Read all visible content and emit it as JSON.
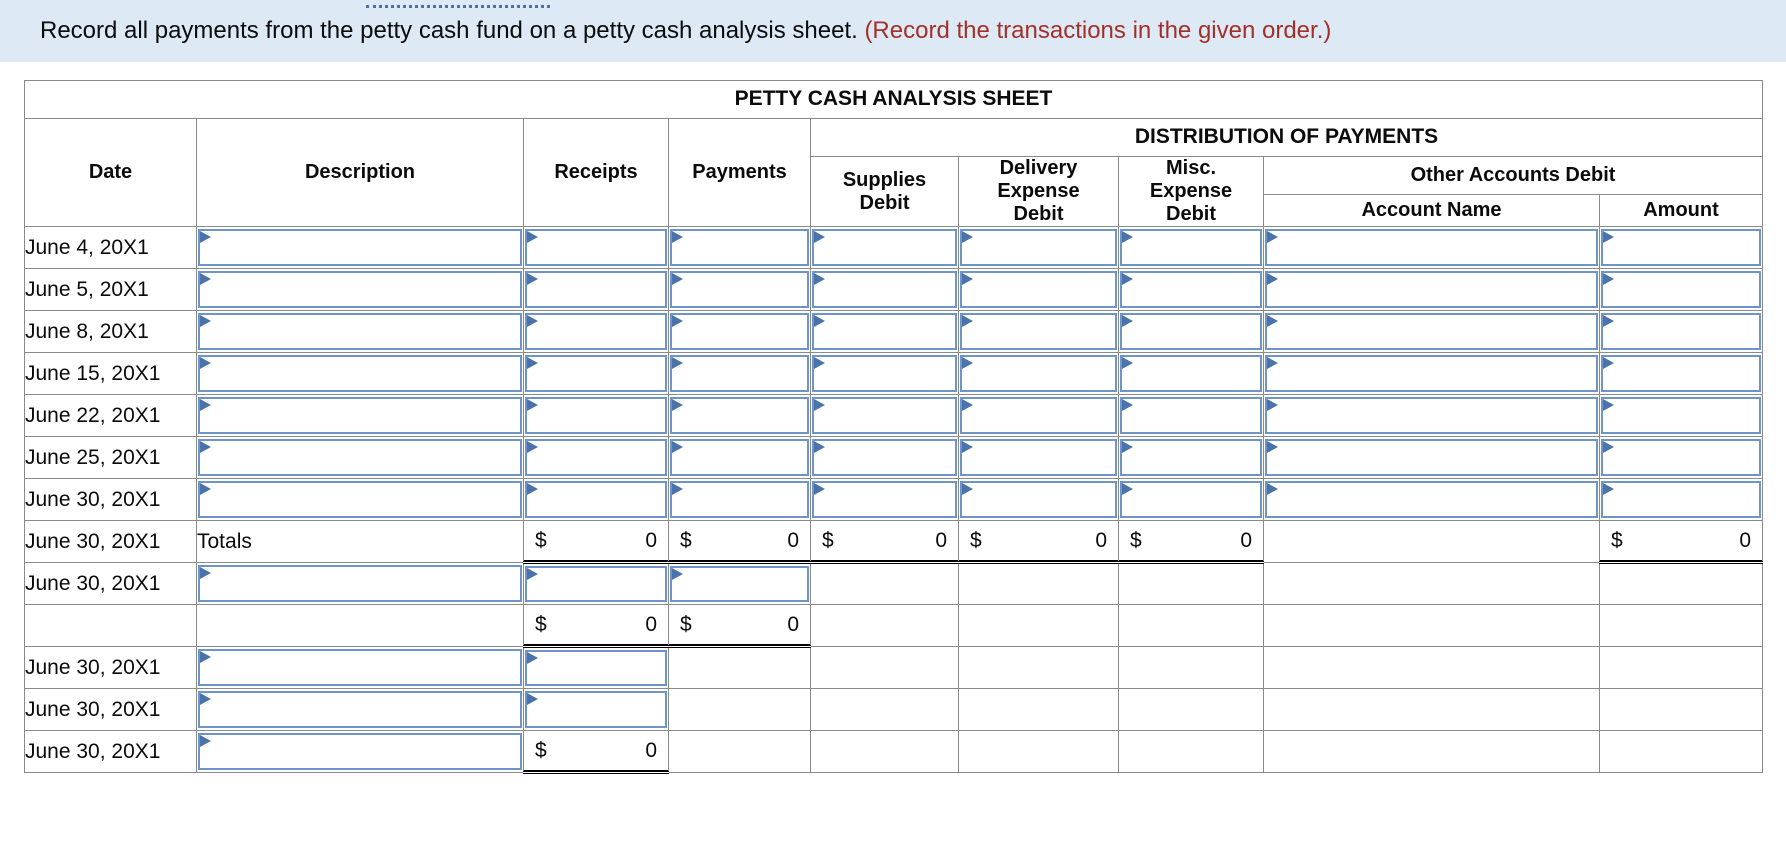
{
  "instruction": {
    "text": "Record all payments from the petty cash fund on a petty cash analysis sheet. ",
    "note": "(Record the transactions in the given order.)"
  },
  "table": {
    "title": "PETTY CASH ANALYSIS SHEET",
    "group_header": "DISTRIBUTION OF PAYMENTS",
    "other_accounts_header": "Other Accounts Debit",
    "columns": {
      "date": "Date",
      "description": "Description",
      "receipts": "Receipts",
      "payments": "Payments",
      "supplies_debit": "Supplies\nDebit",
      "supplies_debit_l1": "Supplies",
      "supplies_debit_l2": "Debit",
      "delivery_expense_l1": "Delivery",
      "delivery_expense_l2": "Expense",
      "delivery_expense_l3": "Debit",
      "misc_expense_l1": "Misc.",
      "misc_expense_l2": "Expense",
      "misc_expense_l3": "Debit",
      "account_name": "Account Name",
      "amount": "Amount"
    },
    "rows": [
      {
        "date": "June 4, 20X1",
        "kind": "entry"
      },
      {
        "date": "June 5, 20X1",
        "kind": "entry"
      },
      {
        "date": "June 8, 20X1",
        "kind": "entry"
      },
      {
        "date": "June 15, 20X1",
        "kind": "entry"
      },
      {
        "date": "June 22, 20X1",
        "kind": "entry"
      },
      {
        "date": "June 25, 20X1",
        "kind": "entry"
      },
      {
        "date": "June 30, 20X1",
        "kind": "entry"
      }
    ],
    "totals_row": {
      "date": "June 30, 20X1",
      "description": "Totals",
      "receipts_symbol": "$",
      "receipts_value": "0",
      "payments_symbol": "$",
      "payments_value": "0",
      "supplies_symbol": "$",
      "supplies_value": "0",
      "delivery_symbol": "$",
      "delivery_value": "0",
      "misc_symbol": "$",
      "misc_value": "0",
      "amount_symbol": "$",
      "amount_value": "0"
    },
    "tail_rows": [
      {
        "date": "June 30, 20X1",
        "kind": "entry-narrow"
      },
      {
        "date": "",
        "kind": "subtotal",
        "receipts_symbol": "$",
        "receipts_value": "0",
        "payments_symbol": "$",
        "payments_value": "0"
      },
      {
        "date": "June 30, 20X1",
        "kind": "entry-receipts"
      },
      {
        "date": "June 30, 20X1",
        "kind": "entry-receipts"
      },
      {
        "date": "June 30, 20X1",
        "kind": "final-total",
        "receipts_symbol": "$",
        "receipts_value": "0"
      }
    ]
  },
  "colors": {
    "banner_bg": "#ddeaf6",
    "header_blue": "#8db1e0",
    "note_red": "#a33028",
    "field_border": "#6f94c8",
    "marker_blue": "#4a72ab"
  }
}
